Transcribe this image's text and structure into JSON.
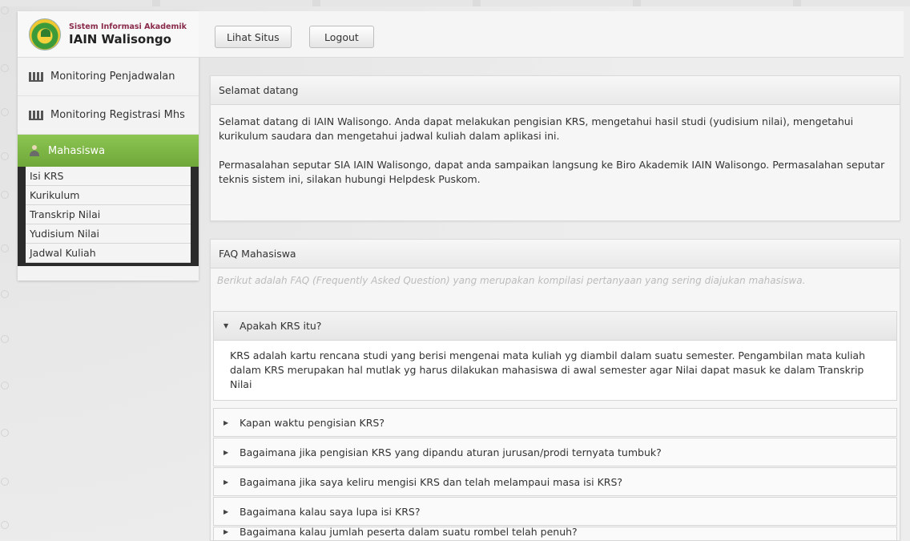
{
  "brand": {
    "subtitle": "Sistem Informasi Akademik",
    "title": "IAIN Walisongo"
  },
  "sidebar": {
    "items": [
      {
        "label": "Monitoring Penjadwalan"
      },
      {
        "label": "Monitoring Registrasi Mhs"
      },
      {
        "label": "Mahasiswa"
      }
    ],
    "sub_items": [
      "Isi KRS",
      "Kurikulum",
      "Transkrip Nilai",
      "Yudisium Nilai",
      "Jadwal Kuliah"
    ]
  },
  "topbar": {
    "view_site_label": "Lihat Situs",
    "logout_label": "Logout"
  },
  "welcome": {
    "title": "Selamat datang",
    "paragraph_1": "Selamat datang di IAIN Walisongo. Anda dapat melakukan pengisian KRS, mengetahui hasil studi (yudisium nilai), mengetahui kurikulum saudara dan mengetahui jadwal kuliah dalam aplikasi ini.",
    "paragraph_2": "Permasalahan seputar SIA IAIN Walisongo, dapat anda sampaikan langsung ke Biro Akademik IAIN Walisongo. Permasalahan seputar teknis sistem ini, silakan hubungi Helpdesk Puskom."
  },
  "faq": {
    "title": "FAQ Mahasiswa",
    "note": "Berikut adalah FAQ (Frequently Asked Question) yang merupakan kompilasi pertanyaan yang sering diajukan mahasiswa.",
    "items": [
      {
        "question": "Apakah KRS itu?",
        "answer": "KRS adalah kartu rencana studi yang berisi mengenai mata kuliah yg diambil dalam suatu semester. Pengambilan mata kuliah dalam KRS merupakan hal mutlak yg harus dilakukan mahasiswa di awal semester agar Nilai dapat masuk ke dalam Transkrip Nilai"
      },
      {
        "question": "Kapan waktu pengisian KRS?"
      },
      {
        "question": "Bagaimana jika pengisian KRS yang dipandu aturan jurusan/prodi ternyata tumbuk?"
      },
      {
        "question": "Bagaimana jika saya keliru mengisi KRS dan telah melampaui masa isi KRS?"
      },
      {
        "question": "Bagaimana kalau saya lupa isi KRS?"
      },
      {
        "question": "Bagaimana kalau jumlah peserta dalam suatu rombel telah penuh?"
      }
    ]
  },
  "colors": {
    "active_nav": "#7db546",
    "submenu_bg": "#2b2b2b"
  },
  "icons": {
    "nav_item": "building-icon",
    "nav_active": "user-icon",
    "caret_open": "caret-down-icon",
    "caret_closed": "caret-right-icon"
  }
}
